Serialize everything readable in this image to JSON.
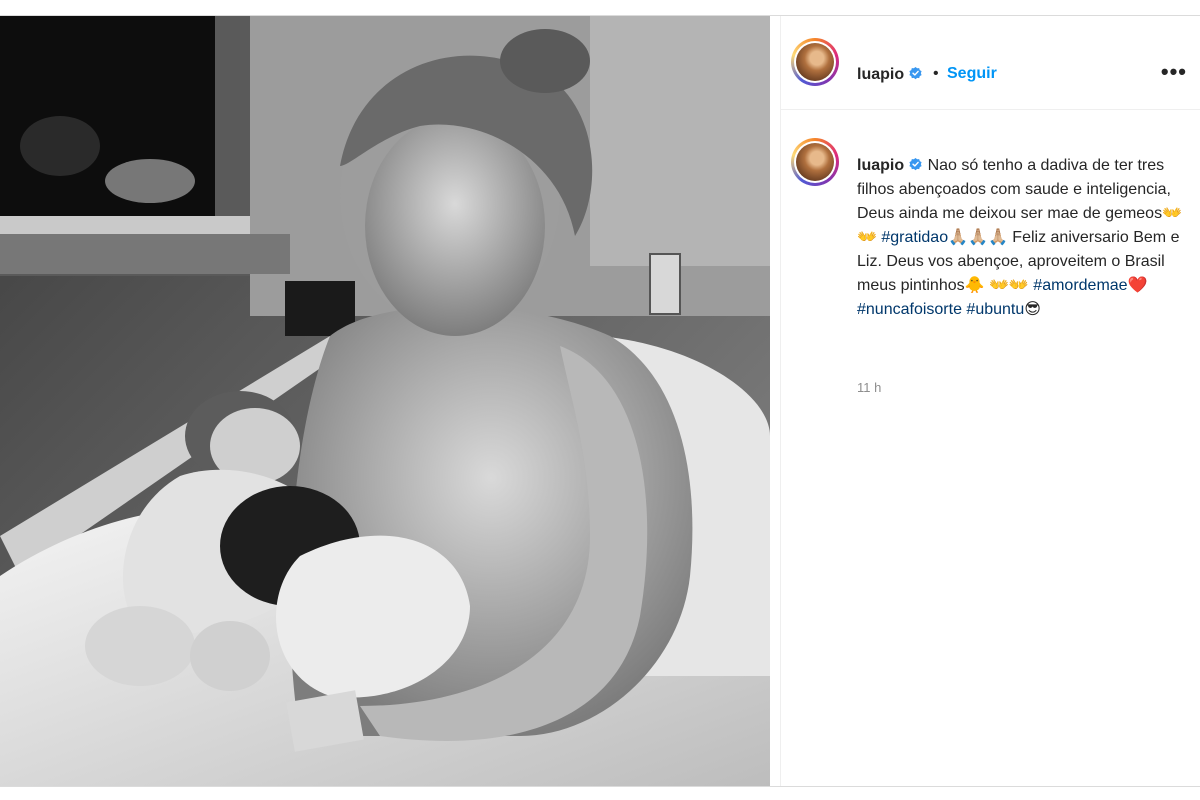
{
  "post": {
    "username": "luapio",
    "follow_label": "Seguir",
    "separator": "•",
    "more_label": "•••"
  },
  "caption": {
    "username": "luapio",
    "text_1": "Nao só tenho a dadiva de ter tres filhos abençoados com saude e inteligencia, Deus ainda me deixou ser mae de gemeos",
    "emoji_1": "👐👐",
    "hashtag_1": "#gratidao",
    "emoji_2": "🙏🏼🙏🏼🙏🏼",
    "text_2": " Feliz aniversario Bem e Liz. Deus vos abençoe, aproveitem o Brasil meus pintinhos",
    "emoji_3": "🐥",
    "emoji_4": "👐👐",
    "hashtag_2": "#amordemae",
    "emoji_5": "❤️",
    "hashtag_3": "#nuncafoisorte",
    "hashtag_4": "#ubuntu",
    "emoji_6": "😎",
    "timestamp": "11 h"
  },
  "colors": {
    "follow": "#0095f6",
    "verified": "#3897f0",
    "hashtag": "#00376b",
    "timestamp": "#8e8e8e"
  },
  "icons": [
    "verified-badge-icon",
    "more-options-icon"
  ]
}
